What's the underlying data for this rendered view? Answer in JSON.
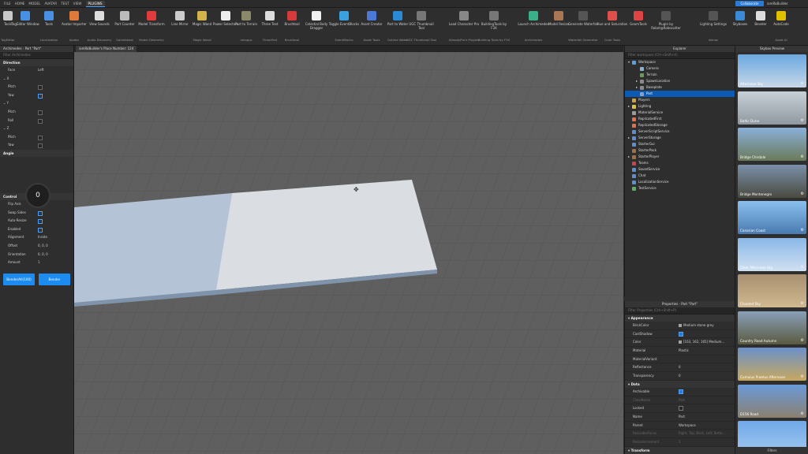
{
  "menubar": {
    "items": [
      "FILE",
      "HOME",
      "MODEL",
      "AVATAR",
      "TEST",
      "VIEW",
      "PLUGINS"
    ],
    "active": "PLUGINS",
    "collaborate": "Collaborate",
    "user": "iamRoBuilder"
  },
  "ribbon": {
    "buttons": [
      {
        "label": "Tools",
        "group": "TagEditor",
        "color": "#c9c9c9"
      },
      {
        "label": "TagEditor Window",
        "group": "",
        "color": "#4a90e2"
      },
      {
        "label": "Tools",
        "group": "Localization",
        "color": "#4a90e2"
      },
      {
        "label": "Avatar Importer",
        "group": "Avatar",
        "color": "#e07a3a"
      },
      {
        "label": "View Sounds",
        "group": "Audio Discovery",
        "color": "#dddddd"
      },
      {
        "label": "Part Counter",
        "group": "Gamebeast",
        "color": "#bbbbbb"
      },
      {
        "label": "Model Transform",
        "group": "Model Geometry",
        "color": "#e23b3b"
      },
      {
        "label": "Line Mirror",
        "group": "",
        "color": "#cccccc"
      },
      {
        "label": "Magic Wand",
        "group": "Magic Wand",
        "color": "#d4b44a"
      },
      {
        "label": "Power Selectors",
        "group": "",
        "color": "#eeeeee"
      },
      {
        "label": "Part to Terrain",
        "group": "imiogus",
        "color": "#8a8a6a"
      },
      {
        "label": "Three Text",
        "group": "ThreeText",
        "color": "#dddddd"
      },
      {
        "label": "Brushtool",
        "group": "Brushtool",
        "color": "#d63b3b"
      },
      {
        "label": "Celestial Body Dragger",
        "group": "",
        "color": "#f0f0f0"
      },
      {
        "label": "Toggle EventBlocks",
        "group": "EventBlocks",
        "color": "#3aa0e0"
      },
      {
        "label": "Asset Creator",
        "group": "Asset Tools",
        "color": "#4a7ad6"
      },
      {
        "label": "Part to Water",
        "group": "Outline Water",
        "color": "#2a8ad6"
      },
      {
        "label": "UGC Thumbnail Tool",
        "group": "UGC Thumbnail Tool",
        "color": "#777777"
      },
      {
        "label": "Load Character Pro",
        "group": "AlreadyPro's Plugins",
        "color": "#888888"
      },
      {
        "label": "BuildingTools by F3X",
        "group": "Building Tools by F3X",
        "color": "#777777"
      },
      {
        "label": "Launch Archimedes",
        "group": "Archimedes",
        "color": "#3ab08a"
      },
      {
        "label": "Model Resize",
        "group": "",
        "color": "#aa7755"
      },
      {
        "label": "Generate Waterfall",
        "group": "Waterfall Generator",
        "color": "#555555"
      },
      {
        "label": "Hue and Saturation",
        "group": "Color Tools",
        "color": "#e0504a"
      },
      {
        "label": "GeomTools",
        "group": "",
        "color": "#dd4444"
      },
      {
        "label": "Plugin by Robot@Robocutter",
        "group": "",
        "color": "#555555"
      },
      {
        "label": "Lighting Settings",
        "group": "Atmos",
        "color": "#555555"
      },
      {
        "label": "Skyboxes",
        "group": "",
        "color": "#3a8ad6"
      },
      {
        "label": "Beveler",
        "group": "",
        "color": "#dddddd"
      },
      {
        "label": "AutoCode",
        "group": "Asset AI",
        "color": "#e0c000"
      }
    ]
  },
  "document_tab": "iamRoBuilder's Place Number: 124",
  "left_panel": {
    "title": "Archimedes - Part \"Part\"",
    "filter_placeholder": "Filter Archimedes",
    "direction_header": "Direction",
    "face_label": "Face",
    "face_value": "Left",
    "x_label": "X",
    "y_label": "Y",
    "z_label": "Z",
    "pitch": "Pitch",
    "yaw": "Yaw",
    "roll": "Roll",
    "angle_header": "Angle",
    "angle_value": "0",
    "control_header": "Control",
    "flip_axis": "Flip Axis",
    "swap_sides": "Swap Sides",
    "auto_resize": "Auto-Resize",
    "enabled": "Enabled",
    "alignment": "Alignment",
    "alignment_value": "Inside",
    "offset": "Offset",
    "offset_value": "0, 0, 0",
    "orientation": "Orientation",
    "orientation_value": "0, 0, 0",
    "amount": "Amount",
    "amount_value": "1",
    "btn_bendall": "BenderAll(100)",
    "btn_bender": "Bender"
  },
  "explorer": {
    "title": "Explorer",
    "filter_placeholder": "Filter workspace (Ctrl+Shift+X)",
    "items": [
      {
        "label": "Workspace",
        "indent": 0,
        "color": "#5aa0e0",
        "arrow": "▾"
      },
      {
        "label": "Camera",
        "indent": 1,
        "color": "#8ab0d0",
        "arrow": ""
      },
      {
        "label": "Terrain",
        "indent": 1,
        "color": "#6a9a5a",
        "arrow": ""
      },
      {
        "label": "SpawnLocation",
        "indent": 1,
        "color": "#8a8a8a",
        "arrow": "▸"
      },
      {
        "label": "Baseplate",
        "indent": 1,
        "color": "#8a8a8a",
        "arrow": "▸"
      },
      {
        "label": "Part",
        "indent": 1,
        "color": "#8aa0c0",
        "arrow": ""
      },
      {
        "label": "Players",
        "indent": 0,
        "color": "#d0a040",
        "arrow": ""
      },
      {
        "label": "Lighting",
        "indent": 0,
        "color": "#e0c040",
        "arrow": "▸"
      },
      {
        "label": "MaterialService",
        "indent": 0,
        "color": "#999999",
        "arrow": ""
      },
      {
        "label": "ReplicatedFirst",
        "indent": 0,
        "color": "#e07050",
        "arrow": ""
      },
      {
        "label": "ReplicatedStorage",
        "indent": 0,
        "color": "#e07050",
        "arrow": ""
      },
      {
        "label": "ServerScriptService",
        "indent": 0,
        "color": "#5a90d0",
        "arrow": ""
      },
      {
        "label": "ServerStorage",
        "indent": 0,
        "color": "#5a90d0",
        "arrow": "▸"
      },
      {
        "label": "StarterGui",
        "indent": 0,
        "color": "#5a90d0",
        "arrow": ""
      },
      {
        "label": "StarterPack",
        "indent": 0,
        "color": "#a07040",
        "arrow": ""
      },
      {
        "label": "StarterPlayer",
        "indent": 0,
        "color": "#a07040",
        "arrow": "▸"
      },
      {
        "label": "Teams",
        "indent": 0,
        "color": "#d04050",
        "arrow": ""
      },
      {
        "label": "SoundService",
        "indent": 0,
        "color": "#5a90d0",
        "arrow": ""
      },
      {
        "label": "Chat",
        "indent": 0,
        "color": "#5a90d0",
        "arrow": ""
      },
      {
        "label": "LocalizationService",
        "indent": 0,
        "color": "#5a90d0",
        "arrow": ""
      },
      {
        "label": "TestService",
        "indent": 0,
        "color": "#5ab060",
        "arrow": ""
      }
    ],
    "selected": "Part"
  },
  "properties": {
    "title": "Properties - Part \"Part\"",
    "filter_placeholder": "Filter Properties (Ctrl+Shift+P)",
    "appearance": "Appearance",
    "data": "Data",
    "transform": "Transform",
    "rows_appearance": [
      {
        "name": "BrickColor",
        "value": "Medium stone grey",
        "swatch": "#a3a2a5"
      },
      {
        "name": "CastShadow",
        "value": "",
        "check": true
      },
      {
        "name": "Color",
        "value": "[163, 162, 165] Medium...",
        "swatch": "#a3a2a5"
      },
      {
        "name": "Material",
        "value": "Plastic"
      },
      {
        "name": "MaterialVariant",
        "value": ""
      },
      {
        "name": "Reflectance",
        "value": "0"
      },
      {
        "name": "Transparency",
        "value": "0"
      }
    ],
    "rows_data": [
      {
        "name": "Archivable",
        "value": "",
        "check": true
      },
      {
        "name": "ClassName",
        "value": "Part",
        "dim": true
      },
      {
        "name": "Locked",
        "value": "",
        "check": false
      },
      {
        "name": "Name",
        "value": "Part"
      },
      {
        "name": "Parent",
        "value": "Workspace"
      },
      {
        "name": "ResizableFaces",
        "value": "Right, Top, Back, Left, Botto...",
        "dim": true
      },
      {
        "name": "ResizeIncrement",
        "value": "1",
        "dim": true
      }
    ]
  },
  "skyboxes": {
    "title": "Skybox Preview",
    "footer": "Filters",
    "items": [
      {
        "label": "Afternoon Sky",
        "top": "#6aa8e0",
        "bottom": "#c8d8e8"
      },
      {
        "label": "Baltic Dune",
        "top": "#c8d0d8",
        "bottom": "#9098a0"
      },
      {
        "label": "Bridge Chirdale",
        "top": "#8ab0d8",
        "bottom": "#6a7a5a"
      },
      {
        "label": "Bridge Montenegro",
        "top": "#7a90a8",
        "bottom": "#4a4a40"
      },
      {
        "label": "Canarian Coast",
        "top": "#8ac0f0",
        "bottom": "#4a7ab0"
      },
      {
        "label": "Clear Afternoon Sky",
        "top": "#8ab8e8",
        "bottom": "#d0e0f0"
      },
      {
        "label": "Clouded Sky",
        "top": "#a89070",
        "bottom": "#d0b890"
      },
      {
        "label": "Country Road Autumn",
        "top": "#8aa0b8",
        "bottom": "#5a5a40"
      },
      {
        "label": "Cumulus Praetus Afternoon",
        "top": "#6a90c8",
        "bottom": "#c8a860"
      },
      {
        "label": "D156 Road",
        "top": "#6a9ad8",
        "bottom": "#8a8070"
      },
      {
        "label": "",
        "top": "#70a8e8",
        "bottom": "#a0c8f0"
      }
    ]
  }
}
